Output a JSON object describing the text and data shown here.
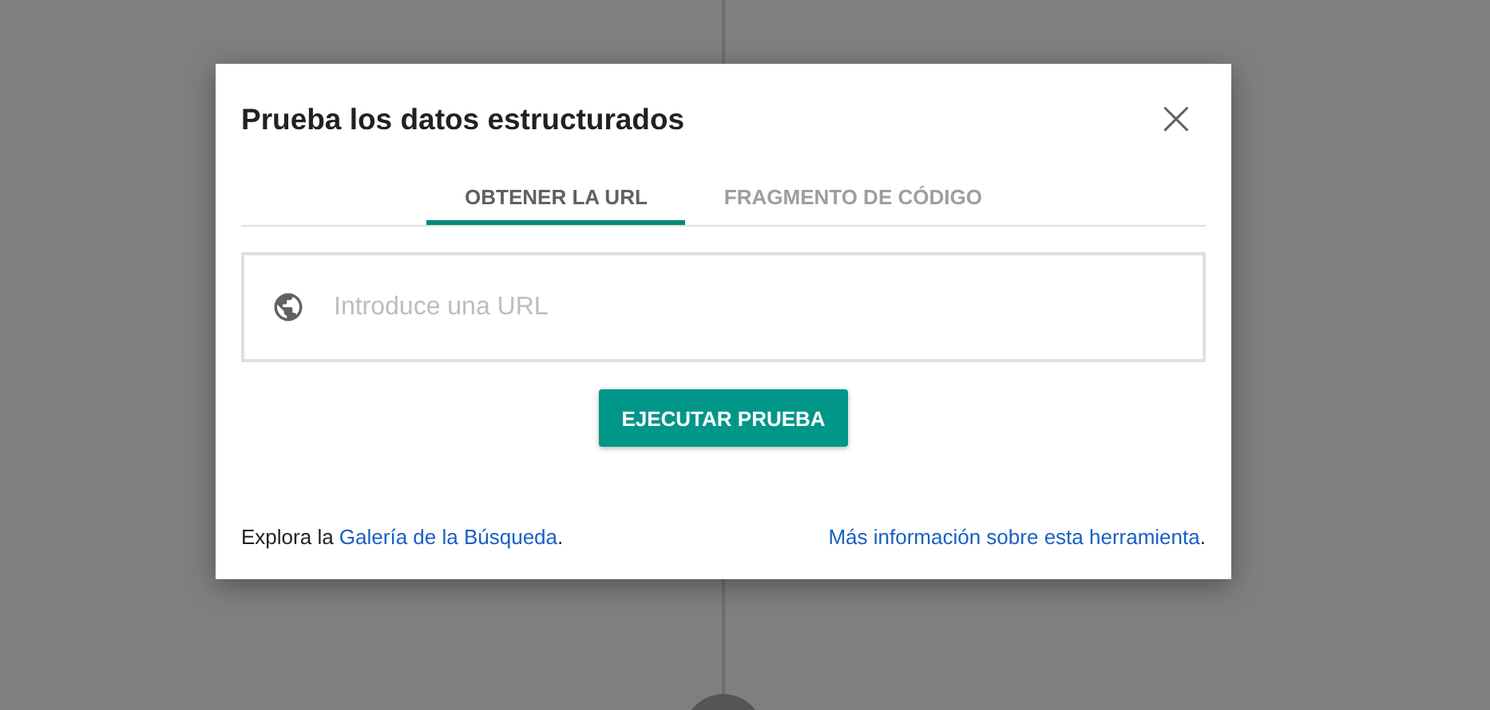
{
  "dialog": {
    "title": "Prueba los datos estructurados",
    "close": "×"
  },
  "tabs": [
    {
      "label": "OBTENER LA URL",
      "selected": true
    },
    {
      "label": "FRAGMENTO DE CÓDIGO",
      "selected": false
    }
  ],
  "url_field": {
    "placeholder": "Introduce una URL"
  },
  "run_button": "EJECUTAR PRUEBA",
  "footer": [
    {
      "before": "Explora la ",
      "link": "Galería de la Búsqueda",
      "after": "."
    },
    {
      "link": "Más información sobre esta herramienta",
      "after": "."
    }
  ]
}
